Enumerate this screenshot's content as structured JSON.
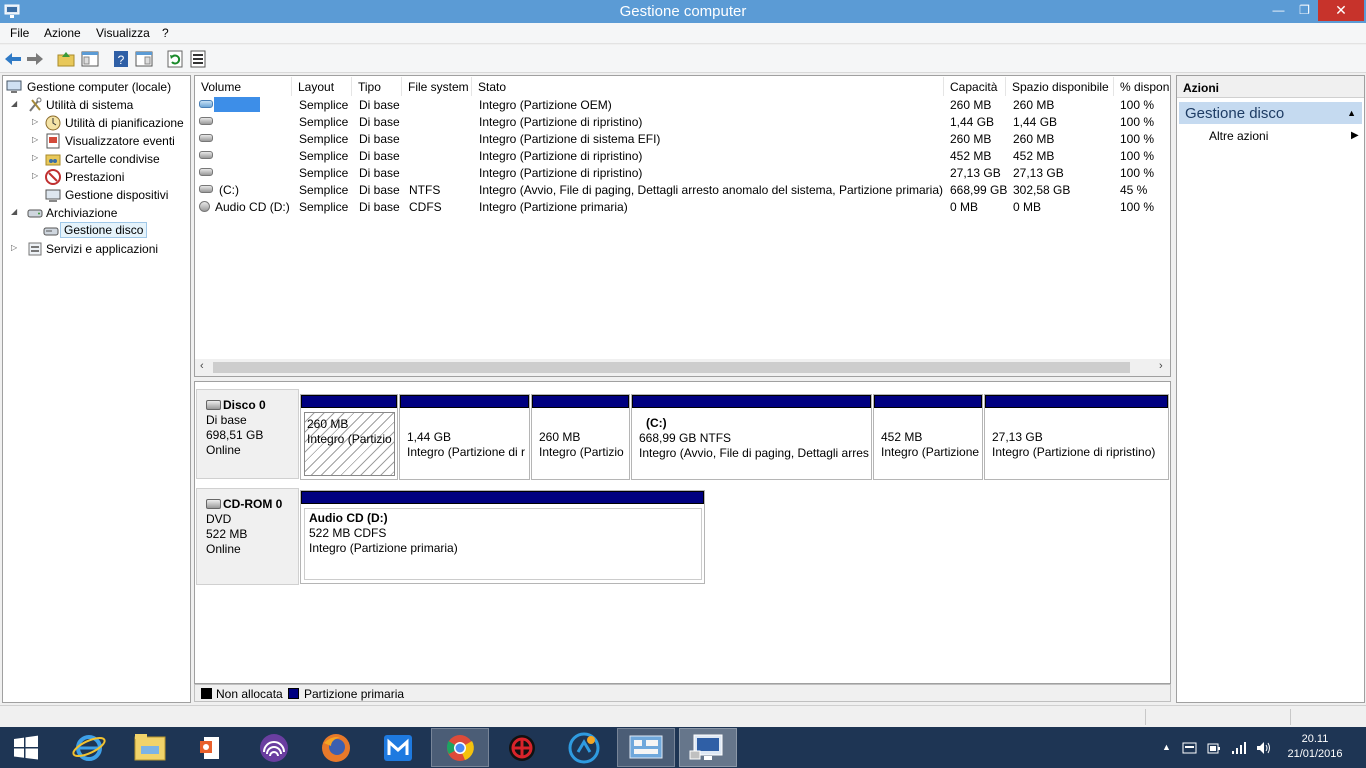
{
  "window": {
    "title": "Gestione computer"
  },
  "menu": [
    "File",
    "Azione",
    "Visualizza",
    "?"
  ],
  "tree": [
    {
      "label": "Gestione computer (locale)",
      "expander": "",
      "icon": "computer-icon"
    },
    {
      "label": "Utilità di sistema",
      "expander": "◢",
      "icon": "tools-icon"
    },
    {
      "label": "Utilità di pianificazione",
      "expander": "▷",
      "icon": "clock-icon"
    },
    {
      "label": "Visualizzatore eventi",
      "expander": "▷",
      "icon": "event-viewer-icon"
    },
    {
      "label": "Cartelle condivise",
      "expander": "▷",
      "icon": "shared-folder-icon"
    },
    {
      "label": "Prestazioni",
      "expander": "▷",
      "icon": "performance-icon"
    },
    {
      "label": "Gestione dispositivi",
      "expander": "",
      "icon": "device-manager-icon"
    },
    {
      "label": "Archiviazione",
      "expander": "◢",
      "icon": "storage-icon"
    },
    {
      "label": "Gestione disco",
      "expander": "",
      "icon": "disk-management-icon",
      "selected": true
    },
    {
      "label": "Servizi e applicazioni",
      "expander": "▷",
      "icon": "services-icon"
    }
  ],
  "volume_table": {
    "columns": [
      "Volume",
      "Layout",
      "Tipo",
      "File system",
      "Stato",
      "Capacità",
      "Spazio disponibile",
      "% disponi"
    ],
    "rows": [
      [
        "",
        "Semplice",
        "Di base",
        "",
        "Integro (Partizione OEM)",
        "260 MB",
        "260 MB",
        "100 %"
      ],
      [
        "",
        "Semplice",
        "Di base",
        "",
        "Integro (Partizione di ripristino)",
        "1,44 GB",
        "1,44 GB",
        "100 %"
      ],
      [
        "",
        "Semplice",
        "Di base",
        "",
        "Integro (Partizione di sistema EFI)",
        "260 MB",
        "260 MB",
        "100 %"
      ],
      [
        "",
        "Semplice",
        "Di base",
        "",
        "Integro (Partizione di ripristino)",
        "452 MB",
        "452 MB",
        "100 %"
      ],
      [
        "",
        "Semplice",
        "Di base",
        "",
        "Integro (Partizione di ripristino)",
        "27,13 GB",
        "27,13 GB",
        "100 %"
      ],
      [
        "(C:)",
        "Semplice",
        "Di base",
        "NTFS",
        "Integro (Avvio, File di paging, Dettagli arresto anomalo del sistema, Partizione primaria)",
        "668,99 GB",
        "302,58 GB",
        "45 %"
      ],
      [
        "Audio CD (D:)",
        "Semplice",
        "Di base",
        "CDFS",
        "Integro (Partizione primaria)",
        "0 MB",
        "0 MB",
        "100 %"
      ]
    ]
  },
  "disks": [
    {
      "name": "Disco 0",
      "type": "Di base",
      "size": "698,51 GB",
      "status": "Online",
      "partitions": [
        {
          "title": "",
          "size": "260 MB",
          "status": "Integro (Partizio"
        },
        {
          "title": "",
          "size": "1,44 GB",
          "status": "Integro (Partizione di r"
        },
        {
          "title": "",
          "size": "260 MB",
          "status": "Integro (Partizio"
        },
        {
          "title": "(C:)",
          "size": "668,99 GB NTFS",
          "status": "Integro (Avvio, File di paging, Dettagli arres"
        },
        {
          "title": "",
          "size": "452 MB",
          "status": "Integro (Partizione"
        },
        {
          "title": "",
          "size": "27,13 GB",
          "status": "Integro (Partizione di ripristino)"
        }
      ]
    },
    {
      "name": "CD-ROM 0",
      "type": "DVD",
      "size": "522 MB",
      "status": "Online",
      "partitions": [
        {
          "title": "Audio CD  (D:)",
          "size": "522 MB CDFS",
          "status": "Integro (Partizione primaria)"
        }
      ]
    }
  ],
  "legend": [
    {
      "label": "Non allocata",
      "color": "#000000"
    },
    {
      "label": "Partizione primaria",
      "color": "#000080"
    }
  ],
  "actions": {
    "header": "Azioni",
    "section": "Gestione disco",
    "item": "Altre azioni"
  },
  "taskbar": {
    "apps": [
      "start-button",
      "internet-explorer",
      "file-explorer",
      "office",
      "torrent-client",
      "firefox",
      "maxthon",
      "chrome",
      "antivirus",
      "cloud-app",
      "control-panel",
      "computer-management"
    ],
    "time": "20.11",
    "date": "21/01/2016"
  },
  "colors": {
    "titlebar": "#5b9bd5",
    "close": "#c7332b",
    "primary_partition": "#000080",
    "taskbar": "#1e3554"
  }
}
